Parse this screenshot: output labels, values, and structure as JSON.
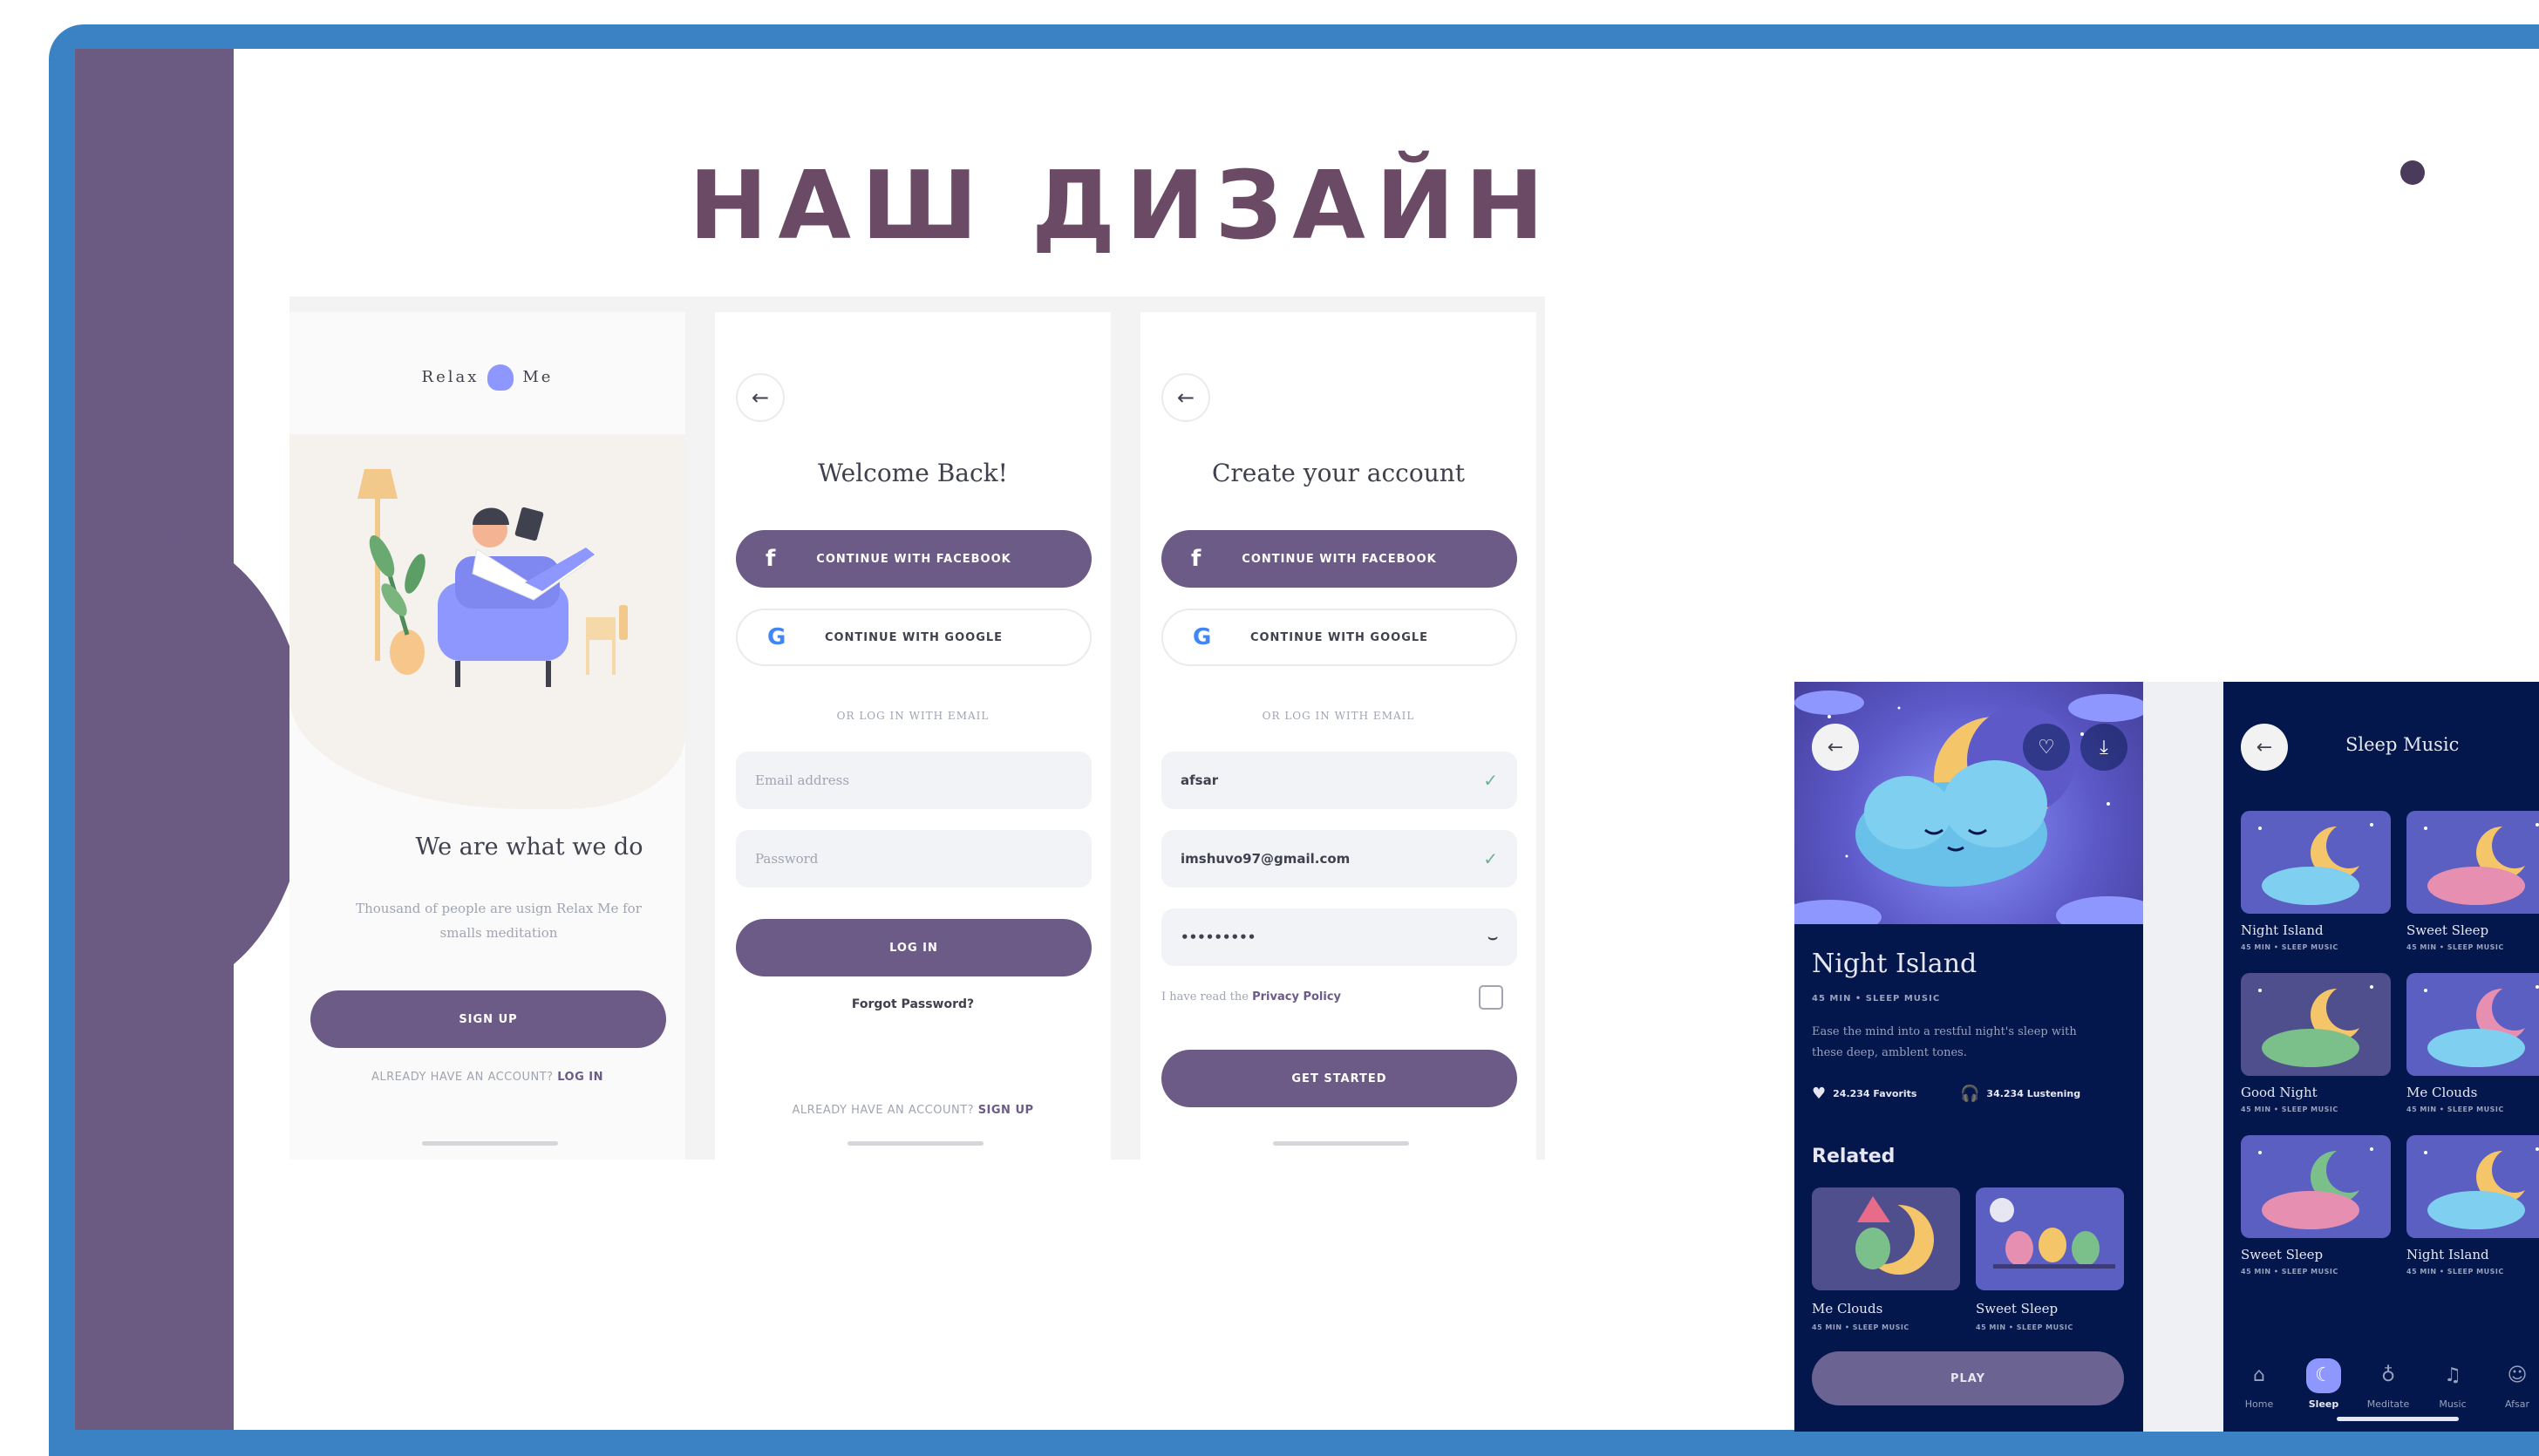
{
  "slide": {
    "title": "НАШ ДИЗАЙН"
  },
  "colors": {
    "frame_blue": "#3b82c4",
    "band_purple": "#6b5b83",
    "title_color": "#6a4a64",
    "button_purple": "#6b5b86",
    "dark_navy": "#03174c",
    "accent_lavender": "#8e97fd"
  },
  "screen_welcome": {
    "logo_left": "Relax",
    "logo_right": "Me",
    "headline": "We are what we do",
    "description": "Thousand of people are usign Relax Me for smalls meditation",
    "signup_button": "SIGN UP",
    "login_prompt": "ALREADY HAVE AN ACCOUNT?",
    "login_link": "LOG IN"
  },
  "screen_login": {
    "back_icon": "arrow-left-icon",
    "title": "Welcome Back!",
    "facebook_button": "CONTINUE WITH FACEBOOK",
    "google_button": "CONTINUE WITH GOOGLE",
    "divider_text": "OR LOG IN WITH EMAIL",
    "email_placeholder": "Email address",
    "password_placeholder": "Password",
    "login_button": "LOG IN",
    "forgot_password": "Forgot Password?",
    "signup_prompt": "ALREADY HAVE AN ACCOUNT?",
    "signup_link": "SIGN UP"
  },
  "screen_signup": {
    "back_icon": "arrow-left-icon",
    "title": "Create your account",
    "facebook_button": "CONTINUE WITH FACEBOOK",
    "google_button": "CONTINUE WITH GOOGLE",
    "divider_text": "OR LOG IN WITH EMAIL",
    "name_value": "afsar",
    "email_value": "imshuvo97@gmail.com",
    "password_value": "•••••••••",
    "privacy_prefix": "I have read the",
    "privacy_link": "Privacy Policy",
    "get_started_button": "GET STARTED"
  },
  "screen_track": {
    "title": "Night Island",
    "meta": "45 MIN  •  SLEEP MUSIC",
    "description": "Ease the mind into a restful night's sleep  with these deep, amblent tones.",
    "favorites": "24.234 Favorits",
    "listening": "34.234 Lustening",
    "related_heading": "Related",
    "related": [
      {
        "label": "Me Clouds",
        "meta": "45 MIN  •  SLEEP MUSIC"
      },
      {
        "label": "Sweet Sleep",
        "meta": "45 MIN  •  SLEEP MUSIC"
      }
    ],
    "play_button": "PLAY"
  },
  "screen_sleep_music": {
    "title": "Sleep Music",
    "items": [
      {
        "label": "Night Island",
        "meta": "45 MIN  •  SLEEP MUSIC"
      },
      {
        "label": "Sweet Sleep",
        "meta": "45 MIN  •  SLEEP MUSIC"
      },
      {
        "label": "Good Night",
        "meta": "45 MIN  •  SLEEP MUSIC"
      },
      {
        "label": "Me Clouds",
        "meta": "45 MIN  •  SLEEP MUSIC"
      },
      {
        "label": "Sweet Sleep",
        "meta": "45 MIN  •  SLEEP MUSIC"
      },
      {
        "label": "Night Island",
        "meta": "45 MIN  •  SLEEP MUSIC"
      }
    ],
    "tabs": [
      {
        "label": "Home",
        "icon": "home-icon"
      },
      {
        "label": "Sleep",
        "icon": "moon-icon"
      },
      {
        "label": "Meditate",
        "icon": "meditate-icon"
      },
      {
        "label": "Music",
        "icon": "music-icon"
      },
      {
        "label": "Afsar",
        "icon": "user-icon"
      }
    ]
  }
}
